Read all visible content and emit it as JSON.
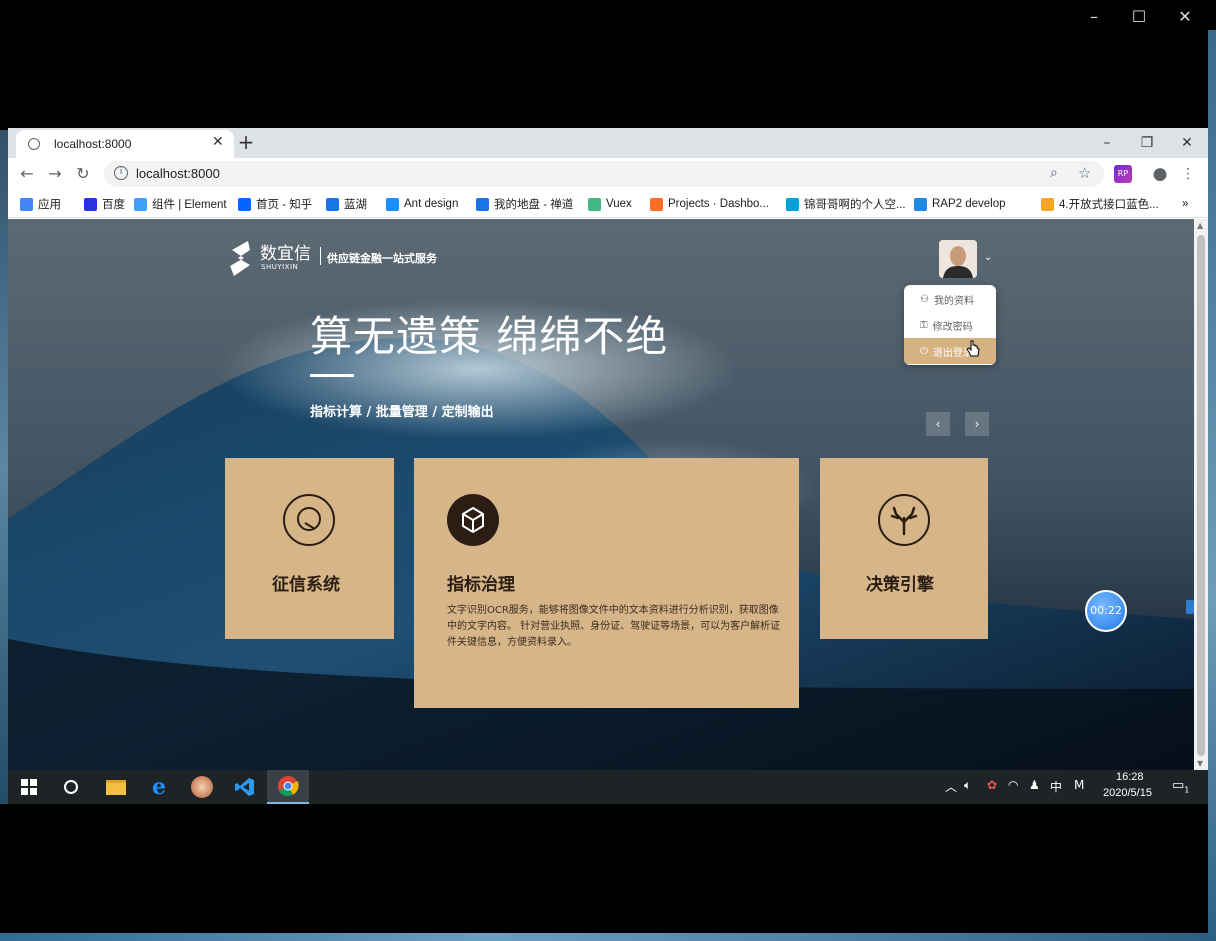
{
  "browser": {
    "tab_title": "localhost:8000",
    "tab_close": "✕",
    "new_tab": "+",
    "url": "localhost:8000"
  },
  "bookmarks": [
    {
      "label": "应用",
      "icon": "apps-grid-icon",
      "color": "#4285f4"
    },
    {
      "label": "百度",
      "icon": "baidu-paw-icon",
      "color": "#2932e1"
    },
    {
      "label": "组件 | Element",
      "icon": "element-logo-icon",
      "color": "#409eff"
    },
    {
      "label": "首页 - 知乎",
      "icon": "zhihu-logo-icon",
      "color": "#0066ff"
    },
    {
      "label": "蓝湖",
      "icon": "lanhu-logo-icon",
      "color": "#1a73e8"
    },
    {
      "label": "Ant design",
      "icon": "ant-design-logo-icon",
      "color": "#1890ff"
    },
    {
      "label": "我的地盘 - 禅道",
      "icon": "zentao-logo-icon",
      "color": "#1a73e8"
    },
    {
      "label": "Vuex",
      "icon": "vue-logo-icon",
      "color": "#41b883"
    },
    {
      "label": "Projects · Dashbo...",
      "icon": "gitlab-logo-icon",
      "color": "#fc6d26"
    },
    {
      "label": "锦哥哥啊的个人空...",
      "icon": "bilibili-logo-icon",
      "color": "#00a1d6"
    },
    {
      "label": "RAP2 develop",
      "icon": "rap2-logo-icon",
      "color": "#1e88e5"
    },
    {
      "label": "4.开放式接口蓝色...",
      "icon": "doc-icon",
      "color": "#f6a623"
    }
  ],
  "header": {
    "brand_cn": "数宜信",
    "brand_en": "SHUYIXIN",
    "slogan": "供应链金融一站式服务",
    "avatar_caret": "⌄"
  },
  "user_menu": {
    "items": [
      {
        "label": "我的资料",
        "icon": "user-icon"
      },
      {
        "label": "修改密码",
        "icon": "lock-icon"
      },
      {
        "label": "退出登录",
        "icon": "power-icon"
      }
    ]
  },
  "hero": {
    "title": "算无遗策 绵绵不绝",
    "subtitle": "指标计算 / 批量管理 / 定制输出",
    "prev": "‹",
    "next": "›"
  },
  "cards": [
    {
      "title": "征信系统",
      "icon": "search-circle-icon"
    },
    {
      "title": "指标治理",
      "icon": "cube-icon",
      "desc": "文字识别OCR服务，能够将图像文件中的文本资料进行分析识别，获取图像中的文字内容。 针对营业执照、身份证、驾驶证等场景，可以为客户解析证件关键信息，方便资料录入。"
    },
    {
      "title": "决策引擎",
      "icon": "tree-branch-icon"
    }
  ],
  "timer": "00:22",
  "taskbar": {
    "tray_ime": "中",
    "tray_m": "M",
    "time": "16:28",
    "date": "2020/5/15",
    "notif_count": "1"
  },
  "colors": {
    "card": "#d6b588",
    "card_text": "#2b1d14",
    "menu_hover": "#d6b182",
    "timer": "#1f7ce8"
  }
}
